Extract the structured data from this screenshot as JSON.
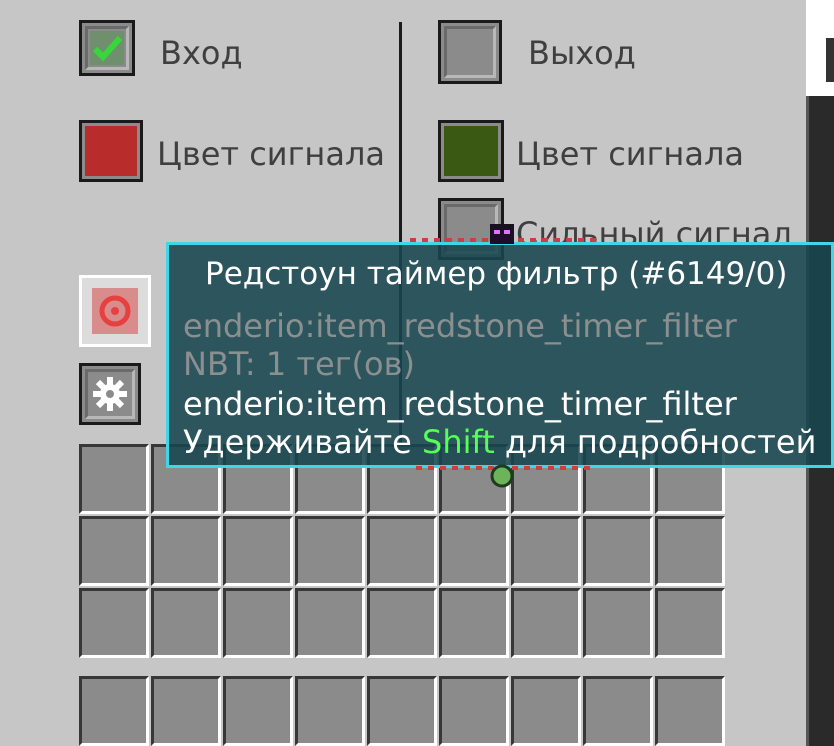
{
  "input_column": {
    "enabled_label": "Вход",
    "color_label": "Цвет сигнала",
    "color_swatch": "#b82c2c"
  },
  "output_column": {
    "enabled_label": "Выход",
    "color_label": "Цвет сигнала",
    "color_swatch": "#3a5a14",
    "strong_signal_label": "Сильный сигнал"
  },
  "tooltip": {
    "title": "Редстоун таймер фильтр (#6149/0)",
    "registry_id": "enderio:item_redstone_timer_filter",
    "nbt": "NBT: 1 тег(ов)",
    "mod_id": "enderio:item_redstone_timer_filter",
    "hint_prefix": "Удерживайте ",
    "hint_key": "Shift",
    "hint_suffix": " для подробностей",
    "border_color": "#3fd6e8"
  },
  "icons": {
    "enabled_check": "checkmark-icon",
    "filter_item": "redstone-timer-filter-icon",
    "settings": "gear-icon"
  }
}
